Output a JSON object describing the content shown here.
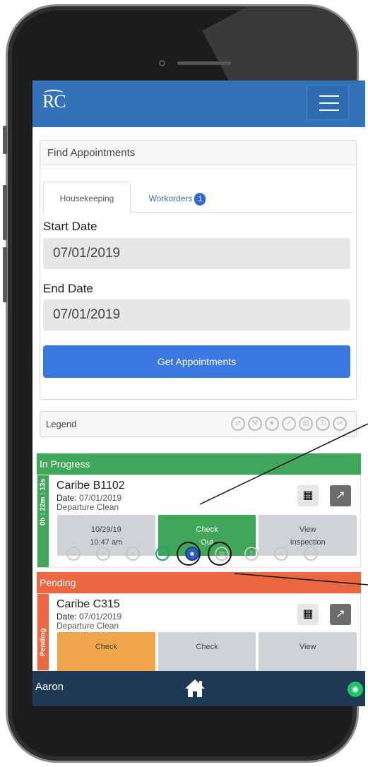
{
  "header": {
    "logo": "RC"
  },
  "find": {
    "title": "Find Appointments",
    "tabs": [
      {
        "label": "Housekeeping"
      },
      {
        "label": "Workorders",
        "badge": "1"
      }
    ],
    "start_label": "Start Date",
    "start_value": "07/01/2019",
    "end_label": "End Date",
    "end_value": "07/01/2019",
    "button": "Get Appointments"
  },
  "legend": {
    "label": "Legend"
  },
  "in_progress": {
    "header": "In Progress",
    "timer": "0h : 22m : 13s",
    "unit": "Caribe B1102",
    "date_label": "Date:",
    "date_value": "07/01/2019",
    "type": "Departure Clean",
    "actions": [
      {
        "line1": "10/29/19",
        "line2": "10:47 am"
      },
      {
        "line1": "Check",
        "line2": "Out"
      },
      {
        "line1": "View",
        "line2": "Inspection"
      }
    ]
  },
  "pending": {
    "header": "Pending",
    "strip": "Pending",
    "unit": "Caribe C315",
    "date_label": "Date:",
    "date_value": "07/01/2019",
    "type": "Departure Clean",
    "actions": [
      {
        "line1": "Check"
      },
      {
        "line1": "Check"
      },
      {
        "line1": "View"
      }
    ]
  },
  "footer": {
    "user": "Aaron"
  },
  "colors": {
    "primary": "#3371b8",
    "progress": "#3fa65a",
    "pending": "#ec6642",
    "footer": "#1f3a55"
  }
}
